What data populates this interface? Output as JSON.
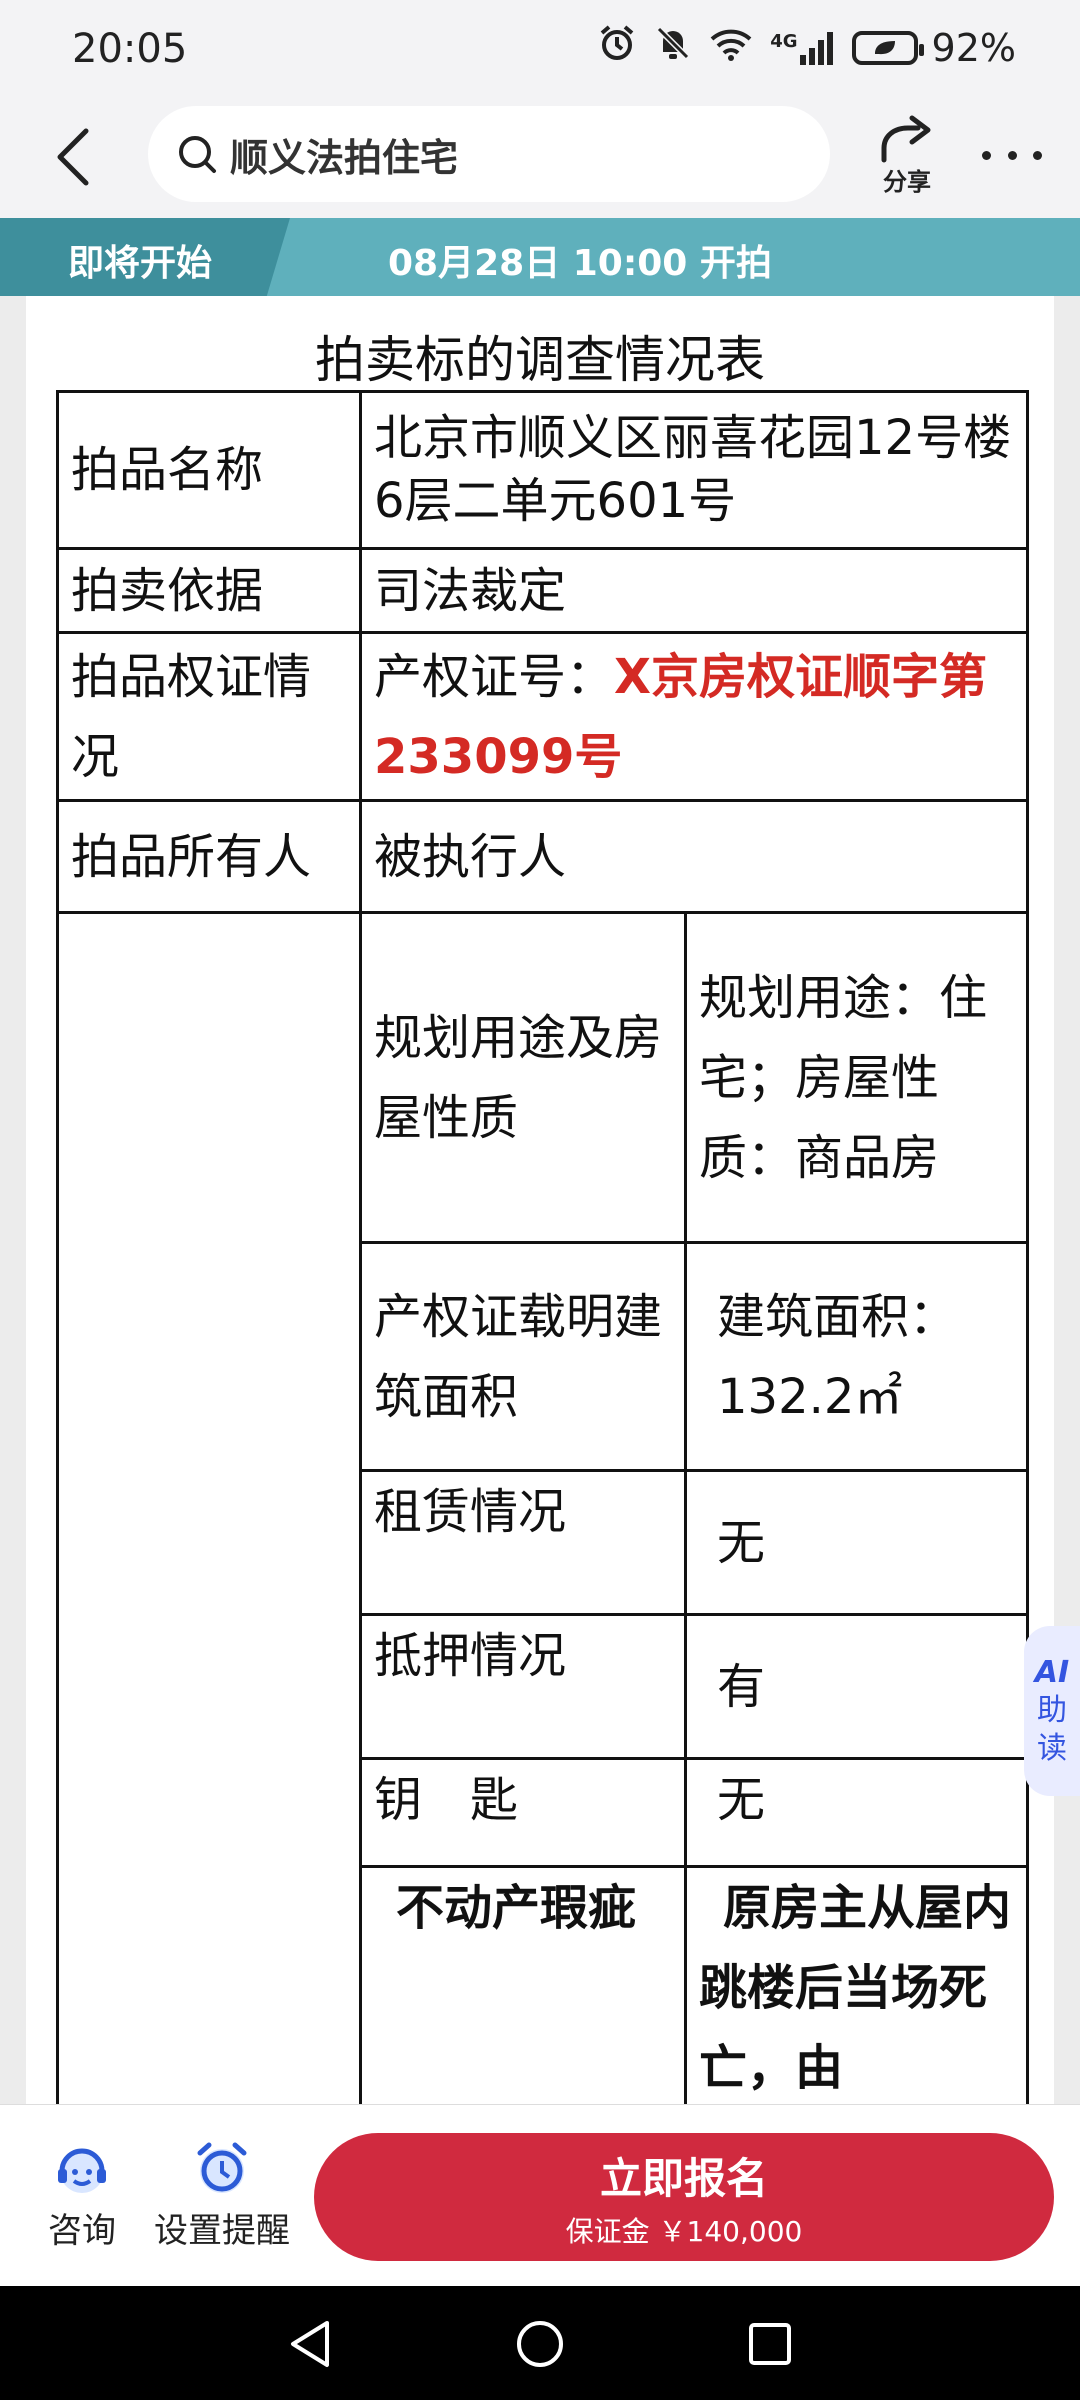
{
  "status_bar": {
    "time": "20:05",
    "network": "4G",
    "battery": "92%"
  },
  "search": {
    "query": "顺义法拍住宅"
  },
  "share": {
    "label": "分享"
  },
  "banner": {
    "status": "即将开始",
    "start_time": "08月28日 10:00 开拍"
  },
  "document": {
    "title": "拍卖标的调查情况表",
    "rows": {
      "name_label": "拍品名称",
      "name_value": "北京市顺义区丽喜花园12号楼6层二单元601号",
      "basis_label": "拍卖依据",
      "basis_value": "司法裁定",
      "cert_label": "拍品权证情况",
      "cert_prefix": "产权证号：",
      "cert_value": "X京房权证顺字第233099号",
      "owner_label": "拍品所有人",
      "owner_value": "被执行人",
      "usage_label": "规划用途及房屋性质",
      "usage_value": "规划用途：住宅；房屋性质：商品房",
      "area_label": "产权证载明建筑面积",
      "area_value": "建筑面积：132.2㎡",
      "lease_label": "租赁情况",
      "lease_value": "无",
      "mortgage_label": "抵押情况",
      "mortgage_value": "有",
      "key_label": "钥　匙",
      "key_value": "无",
      "defect_label": "不动产瑕疵",
      "defect_value": "原房主从屋内跳楼后当场死亡，由"
    }
  },
  "ai_assist": {
    "line1": "AI",
    "line2": "助",
    "line3": "读"
  },
  "action_bar": {
    "consult_label": "咨询",
    "reminder_label": "设置提醒",
    "signup_label": "立即报名",
    "deposit_label": "保证金 ￥140,000"
  }
}
